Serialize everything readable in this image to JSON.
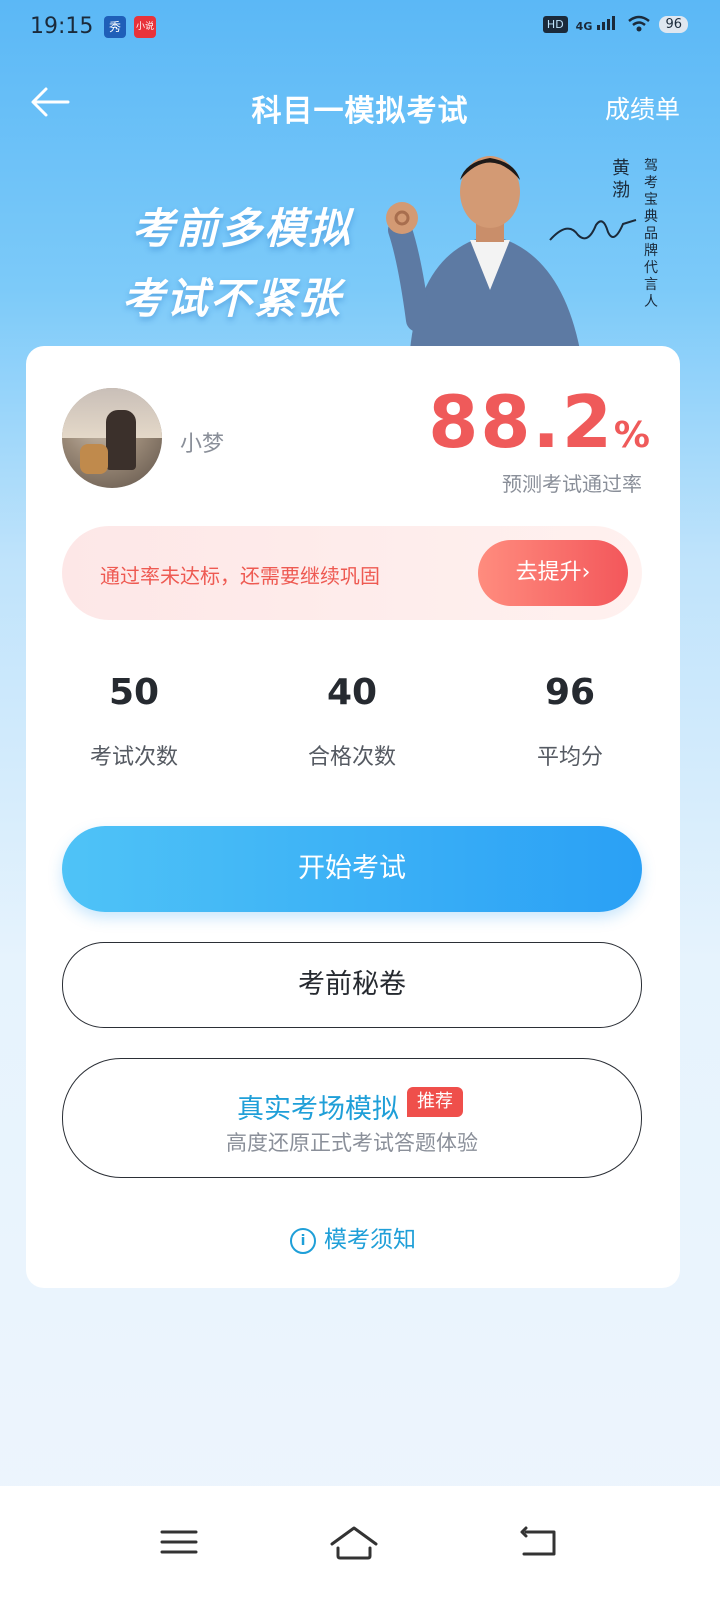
{
  "status_bar": {
    "time": "19:15",
    "app1_icon": "秀",
    "app2_icon": "小说",
    "hd": "HD",
    "network": "4G",
    "battery": "96"
  },
  "header": {
    "title": "科目一模拟考试",
    "right_link": "成绩单"
  },
  "banner": {
    "slogan_line1": "考前多模拟",
    "slogan_line2": "考试不紧张",
    "spokesperson_name": "黄渤",
    "spokesperson_role": "驾考宝典品牌代言人"
  },
  "profile": {
    "username": "小梦",
    "pass_rate": "88.2",
    "pass_rate_unit": "%",
    "pass_rate_label": "预测考试通过率"
  },
  "alert": {
    "message": "通过率未达标，还需要继续巩固",
    "button": "去提升"
  },
  "stats": [
    {
      "value": "50",
      "label": "考试次数"
    },
    {
      "value": "40",
      "label": "合格次数"
    },
    {
      "value": "96",
      "label": "平均分"
    }
  ],
  "actions": {
    "start_exam": "开始考试",
    "secret_paper": "考前秘卷",
    "real_sim_title": "真实考场模拟",
    "real_sim_tag": "推荐",
    "real_sim_sub": "高度还原正式考试答题体验",
    "notice": "模考须知"
  },
  "colors": {
    "accent_blue": "#2aa0f5",
    "alert_red": "#ef5a5a",
    "link_blue": "#1f9fd8"
  }
}
